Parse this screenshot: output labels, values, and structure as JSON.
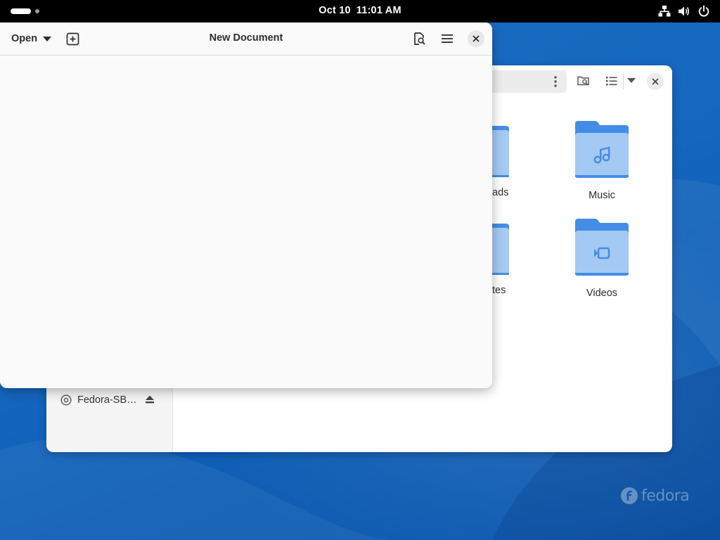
{
  "topbar": {
    "date": "Oct 10",
    "time": "11:01 AM",
    "icons": [
      "activities-indicator",
      "network-wired-icon",
      "volume-icon",
      "power-icon"
    ]
  },
  "files_window": {
    "sidebar": {
      "drive_label": "Fedora-SB…",
      "drive_icon": "optical-disc-icon",
      "eject_icon": "eject-icon"
    },
    "toolbar_icons": [
      "kebab-menu-icon",
      "search-folder-icon",
      "list-view-icon",
      "view-options-dropdown-icon",
      "close-icon"
    ],
    "partial_labels": [
      "ads",
      "tes"
    ],
    "folders": [
      {
        "label": "Music",
        "icon": "music-note-icon"
      },
      {
        "label": "Videos",
        "icon": "video-icon"
      }
    ],
    "folder_color": "#438de6",
    "folder_light_color": "#a4c9f2"
  },
  "editor_window": {
    "open_label": "Open",
    "title": "New Document",
    "header_icons": [
      "new-tab-icon",
      "find-icon",
      "hamburger-menu-icon",
      "close-icon"
    ],
    "content": ""
  },
  "desktop": {
    "watermark_text": "fedora",
    "background_color": "#1565b8"
  }
}
